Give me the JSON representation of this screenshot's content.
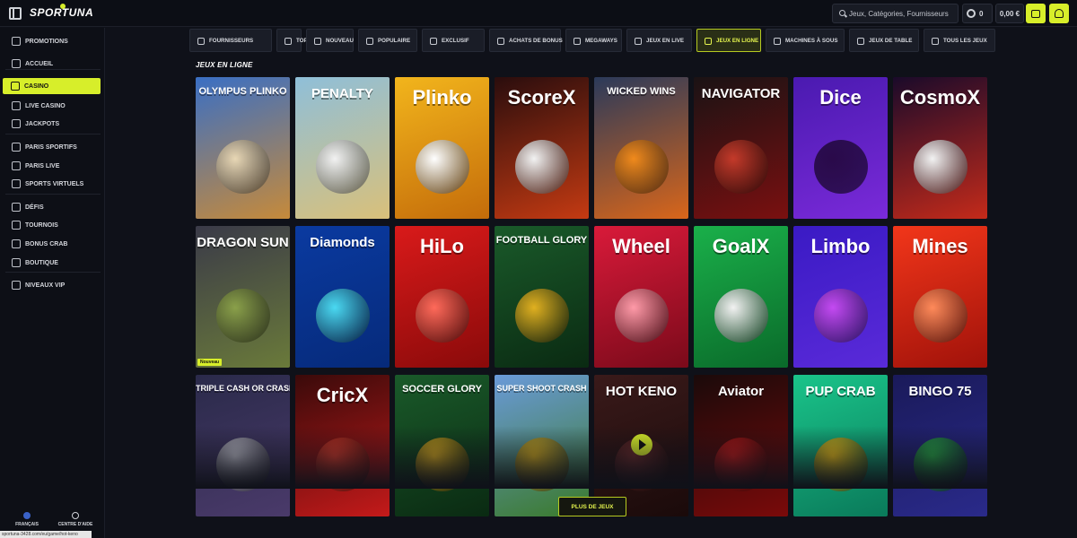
{
  "header": {
    "logo": "SPORTUNA",
    "search_placeholder": "Jeux, Catégories, Fournisseurs",
    "coins": "0",
    "balance": "0,00 €"
  },
  "sidebar": {
    "items": [
      {
        "label": "PROMOTIONS",
        "icon": "gift-icon"
      },
      {
        "label": "ACCUEIL",
        "icon": "home-icon"
      },
      {
        "label": "CASINO",
        "icon": "casino-icon",
        "active": true
      },
      {
        "label": "LIVE CASINO",
        "icon": "live-casino-icon"
      },
      {
        "label": "JACKPOTS",
        "icon": "jackpot-icon"
      },
      {
        "label": "PARIS SPORTIFS",
        "icon": "sports-icon"
      },
      {
        "label": "PARIS LIVE",
        "icon": "live-icon"
      },
      {
        "label": "SPORTS VIRTUELS",
        "icon": "virtual-sports-icon"
      },
      {
        "label": "DÉFIS",
        "icon": "challenge-icon"
      },
      {
        "label": "TOURNOIS",
        "icon": "trophy-icon"
      },
      {
        "label": "BONUS CRAB",
        "icon": "crab-icon"
      },
      {
        "label": "BOUTIQUE",
        "icon": "shop-icon"
      },
      {
        "label": "NIVEAUX VIP",
        "icon": "diamond-icon"
      }
    ],
    "footer": {
      "language": "FRANÇAIS",
      "help": "CENTRE D'AIDE"
    }
  },
  "status_url": "sportuna-3428.com/eu/game/hot-keno",
  "tabs": [
    {
      "label": "FOURNISSEURS",
      "icon": "layers-icon"
    },
    {
      "label": "TOP",
      "icon": "crown-icon"
    },
    {
      "label": "NOUVEAU",
      "icon": "bolt-icon"
    },
    {
      "label": "POPULAIRE",
      "icon": "flame-icon"
    },
    {
      "label": "EXCLUSIF",
      "icon": "gem-icon"
    },
    {
      "label": "ACHATS DE BONUS",
      "icon": "bag-icon"
    },
    {
      "label": "MEGAWAYS",
      "icon": "megaways-icon"
    },
    {
      "label": "JEUX EN LIVE",
      "icon": "live-games-icon"
    },
    {
      "label": "JEUX EN LIGNE",
      "icon": "gamepad-icon",
      "active": true
    },
    {
      "label": "MACHINES À SOUS",
      "icon": "slot-icon"
    },
    {
      "label": "JEUX DE TABLE",
      "icon": "chip-icon"
    },
    {
      "label": "TOUS LES JEUX",
      "icon": "grid-icon"
    }
  ],
  "section_title": "JEUX EN LIGNE",
  "games": [
    {
      "title": "OLYMPUS PLINKO",
      "bg": "#3a6fc4",
      "bg2": "#c68a3a",
      "art": "#e8d7b5"
    },
    {
      "title": "PENALTY",
      "bg": "#8fbfd9",
      "bg2": "#d9c07a",
      "art": "#f2f2f2"
    },
    {
      "title": "Plinko",
      "bg": "#f2b51c",
      "bg2": "#c46c0a",
      "art": "#ffffff"
    },
    {
      "title": "ScoreX",
      "bg": "#2a0d0d",
      "bg2": "#c43a12",
      "art": "#f2f2f2"
    },
    {
      "title": "WICKED WINS",
      "bg": "#2b3a5a",
      "bg2": "#d9661a",
      "art": "#f08a1c"
    },
    {
      "title": "NAVIGATOR",
      "bg": "#1a1214",
      "bg2": "#7a1010",
      "art": "#c43a2a"
    },
    {
      "title": "Dice",
      "bg": "#4a1ab0",
      "bg2": "#7a2ad9",
      "art": "#2a0a4a"
    },
    {
      "title": "CosmoX",
      "bg": "#1a0a2a",
      "bg2": "#c42a1a",
      "art": "#f2f2f2"
    },
    {
      "title": "DRAGON SUN",
      "bg": "#3a3a48",
      "bg2": "#6a7a3a",
      "art": "#8aa04a"
    },
    {
      "title": "Diamonds",
      "bg": "#0a3aa0",
      "bg2": "#062a7a",
      "art": "#4ad9f2"
    },
    {
      "title": "HiLo",
      "bg": "#d91a1a",
      "bg2": "#8a0a0a",
      "art": "#ff6a5a"
    },
    {
      "title": "FOOTBALL GLORY",
      "bg": "#1a5a2a",
      "bg2": "#0a2a12",
      "art": "#e0b020"
    },
    {
      "title": "Wheel",
      "bg": "#d91a3a",
      "bg2": "#7a0a1a",
      "art": "#ff9aa8"
    },
    {
      "title": "GoalX",
      "bg": "#1ab04a",
      "bg2": "#0a6a2a",
      "art": "#f2f2f2"
    },
    {
      "title": "Limbo",
      "bg": "#3a1ac4",
      "bg2": "#5a2ad9",
      "art": "#c44af2"
    },
    {
      "title": "Mines",
      "bg": "#f2361a",
      "bg2": "#a0120a",
      "art": "#ff8a5a"
    },
    {
      "title": "TRIPLE CASH OR CRASH",
      "bg": "#2a2a4a",
      "bg2": "#4a3a6a",
      "art": "#c4c4d0"
    },
    {
      "title": "CricX",
      "bg": "#3a0a0a",
      "bg2": "#c41a1a",
      "art": "#d93a2a"
    },
    {
      "title": "SOCCER GLORY",
      "bg": "#1a5a2a",
      "bg2": "#0a2a12",
      "art": "#e0b020"
    },
    {
      "title": "SUPER SHOOT CRASH",
      "bg": "#6a9ad9",
      "bg2": "#3a7a2a",
      "art": "#d9b020"
    },
    {
      "title": "HOT KENO",
      "bg": "#3a1a1a",
      "bg2": "#1a0a0a",
      "art": "#6a2a2a"
    },
    {
      "title": "Aviator",
      "bg": "#1a0a0a",
      "bg2": "#7a0a0a",
      "art": "#c41a1a"
    },
    {
      "title": "PUP CRAB",
      "bg": "#1ac48a",
      "bg2": "#0a7a5a",
      "art": "#f2c41a"
    },
    {
      "title": "BINGO 75",
      "bg": "#1a1a5a",
      "bg2": "#2a2a8a",
      "art": "#2ab04a"
    }
  ],
  "new_badge": "Nouveau",
  "more_button": "PLUS DE JEUX"
}
